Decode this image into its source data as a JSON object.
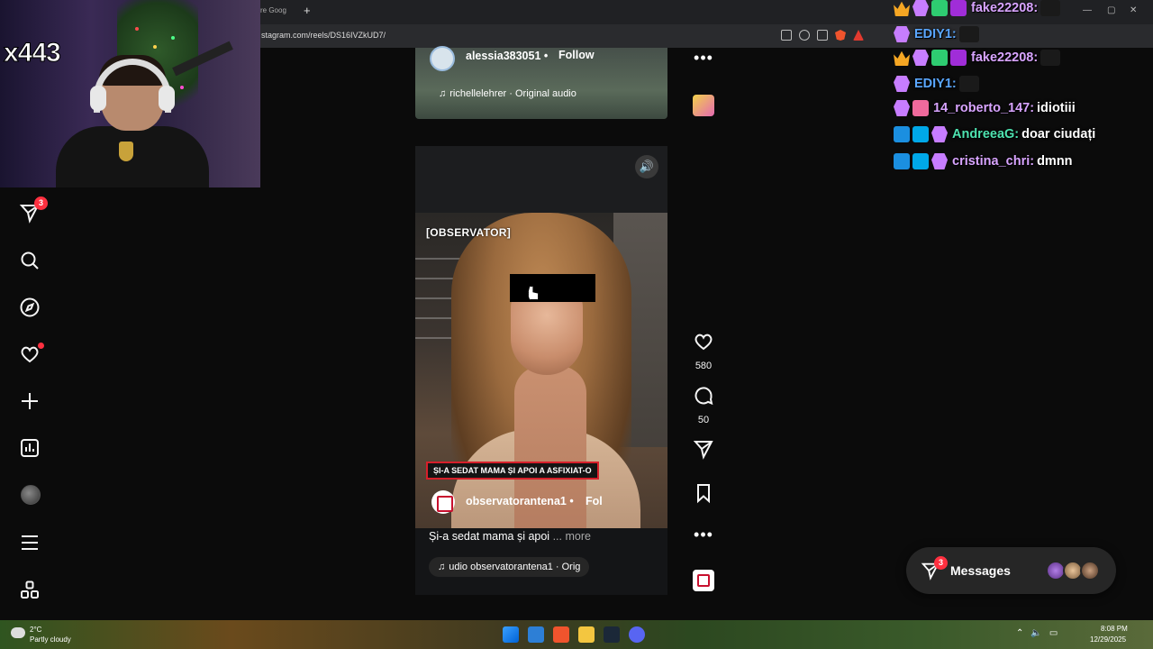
{
  "browser": {
    "tab_fragment": "re Goog",
    "new_tab": "+",
    "url": "stagram.com/reels/DS16IVZkUD7/"
  },
  "webcam": {
    "counter": "x443"
  },
  "left_nav": {
    "messages_badge": "3"
  },
  "previous_reel": {
    "username": "alessia383051",
    "separator": "•",
    "follow_label": "Follow",
    "audio": "richellelehrer · Original audio"
  },
  "current_reel": {
    "watermark": "[OBSERVATOR]",
    "caption_banner": "ȘI-A SEDAT MAMA ȘI APOI A ASFIXIAT-O",
    "username": "observatorantena1",
    "separator": "•",
    "follow_label": "Fol",
    "caption": "Și-a sedat mama și apoi ",
    "caption_more": "... more",
    "audio": "udio  observatorantena1 · Orig"
  },
  "actions": {
    "likes": "580",
    "comments": "50",
    "more_glyph": "•••"
  },
  "chat": [
    {
      "name": "fake22208:",
      "name_color": "#d8a4ff",
      "message": "",
      "badges": [
        "crown",
        "space",
        "gift",
        "sub"
      ]
    },
    {
      "name": "EDIY1:",
      "name_color": "#5aa7ff",
      "message": "",
      "badges": [
        "space"
      ]
    },
    {
      "name": "fake22208:",
      "name_color": "#d8a4ff",
      "message": "",
      "badges": [
        "crown",
        "space",
        "gift",
        "sub"
      ]
    },
    {
      "name": "EDIY1:",
      "name_color": "#5aa7ff",
      "message": "",
      "badges": [
        "space"
      ]
    },
    {
      "name": "14_roberto_147:",
      "name_color": "#d8a4ff",
      "message": "idiotiii",
      "badges": [
        "space",
        "cake"
      ]
    },
    {
      "name": "AndreeaG:",
      "name_color": "#4ee3b0",
      "message": "doar ciudați",
      "badges": [
        "wand",
        "bg",
        "space"
      ]
    },
    {
      "name": "cristina_chri:",
      "name_color": "#d8a4ff",
      "message": "dmnn",
      "badges": [
        "wand",
        "bg",
        "space"
      ]
    }
  ],
  "messages_pill": {
    "label": "Messages",
    "badge": "3"
  },
  "taskbar": {
    "temperature": "2°C",
    "weather": "Partly cloudy",
    "time": "8:08 PM",
    "date": "12/29/2025"
  },
  "colors": {
    "instagram_red": "#ff3040",
    "observator_red": "#d71f2a",
    "page_bg": "#0b0b0b"
  }
}
